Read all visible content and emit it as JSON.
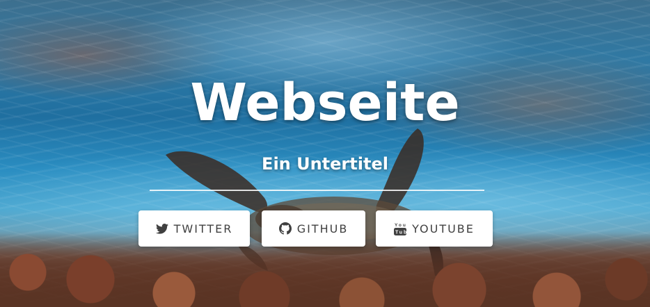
{
  "hero": {
    "title": "Webseite",
    "subtitle": "Ein Untertitel"
  },
  "buttons": [
    {
      "label": "TWITTER",
      "icon": "twitter-icon"
    },
    {
      "label": "GITHUB",
      "icon": "github-icon"
    },
    {
      "label": "YOUTUBE",
      "icon": "youtube-icon"
    }
  ],
  "colors": {
    "button_background": "#ffffff",
    "button_text": "#404040",
    "title_text": "#ffffff"
  }
}
